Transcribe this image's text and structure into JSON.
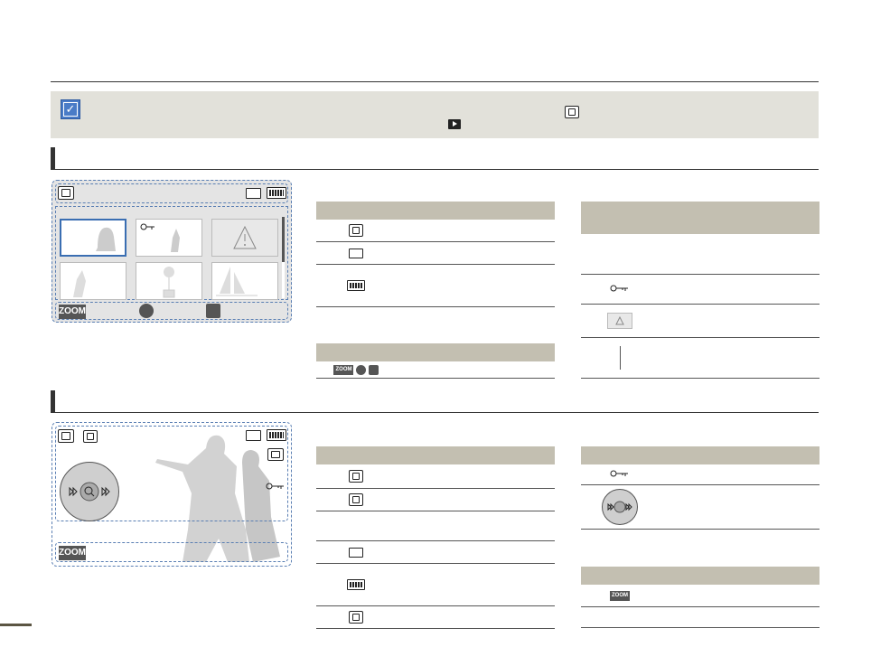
{
  "screen1": {
    "zoom_label": "ZOOM"
  },
  "screen2": {
    "zoom_label": "ZOOM"
  },
  "table_zoom": {
    "zoom_label": "ZOOM"
  },
  "table_zoom2": {
    "zoom_label": "ZOOM"
  },
  "icons": {
    "play_mode": "photo-play-mode-icon",
    "card": "memory-card-icon",
    "battery": "battery-icon",
    "protect": "protect-key-icon",
    "warning": "warning-icon",
    "scroll": "scroll-bar-icon",
    "slide": "slideshow-icon",
    "resolution": "photo-resolution-icon",
    "wheel": "playback-wheel-icon"
  },
  "colors": {
    "accent": "#4a7cc7",
    "table_header": "#c3bfb1",
    "note_band": "#e2e1da",
    "screen_border": "#5a7fb3"
  }
}
